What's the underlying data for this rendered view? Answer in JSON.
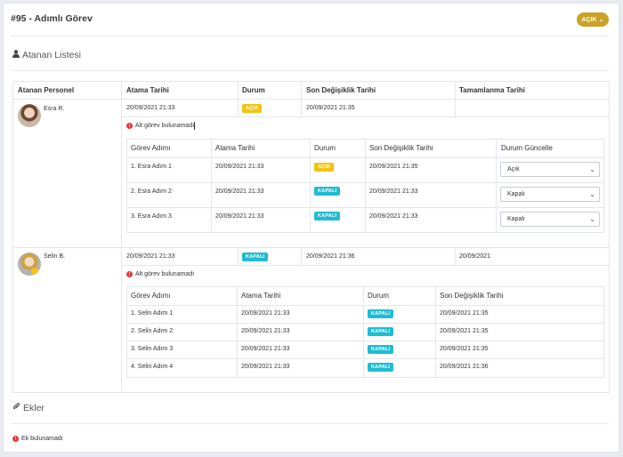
{
  "header": {
    "title": "#95 - Adımlı Görev",
    "status_button": "AÇIK"
  },
  "assignee_section": {
    "title": "Atanan Listesi"
  },
  "main_table": {
    "headers": [
      "Atanan Personel",
      "Atama Tarihi",
      "Durum",
      "Son Değişiklik Tarihi",
      "Tamamlanma Tarihi"
    ]
  },
  "assignees": [
    {
      "name": "Esra R.",
      "assigned": "20/09/2021 21:33",
      "status": "AÇIK",
      "modified": "20/09/2021 21:35",
      "completed": "",
      "no_subtask": "Alt görev bulunamadı",
      "steps_headers": [
        "Görev Adımı",
        "Atama Tarihi",
        "Durum",
        "Son Değişiklik Tarihi",
        "Durum Güncelle"
      ],
      "steps": [
        {
          "name": "1. Esra Adım 1",
          "assigned": "20/09/2021 21:33",
          "status": "AÇIK",
          "modified": "20/09/2021 21:35",
          "select": "Açık"
        },
        {
          "name": "2. Esra Adım 2",
          "assigned": "20/09/2021 21:33",
          "status": "KAPALI",
          "modified": "20/09/2021 21:33",
          "select": "Kapalı"
        },
        {
          "name": "3. Esra Adım 3",
          "assigned": "20/09/2021 21:33",
          "status": "KAPALI",
          "modified": "20/09/2021 21:33",
          "select": "Kapalı"
        }
      ]
    },
    {
      "name": "Selin B.",
      "assigned": "20/09/2021 21:33",
      "status": "KAPALI",
      "modified": "20/09/2021 21:36",
      "completed": "20/09/2021",
      "no_subtask": "Alt görev bulunamadı",
      "steps_headers": [
        "Görev Adımı",
        "Atama Tarihi",
        "Durum",
        "Son Değişiklik Tarihi"
      ],
      "steps": [
        {
          "name": "1. Selin Adım 1",
          "assigned": "20/09/2021 21:33",
          "status": "KAPALI",
          "modified": "20/09/2021 21:35"
        },
        {
          "name": "2. Selin Adım 2",
          "assigned": "20/09/2021 21:33",
          "status": "KAPALI",
          "modified": "20/09/2021 21:35"
        },
        {
          "name": "3. Selin Adım 3",
          "assigned": "20/09/2021 21:33",
          "status": "KAPALI",
          "modified": "20/09/2021 21:35"
        },
        {
          "name": "4. Selin Adım 4",
          "assigned": "20/09/2021 21:33",
          "status": "KAPALI",
          "modified": "20/09/2021 21:36"
        }
      ]
    }
  ],
  "attachments": {
    "title": "Ekler",
    "empty": "Ek bulunamadı"
  },
  "colors": {
    "accent": "#c9a227",
    "open": "#f1c40f",
    "closed": "#1fbcd2",
    "error": "#e53935"
  }
}
